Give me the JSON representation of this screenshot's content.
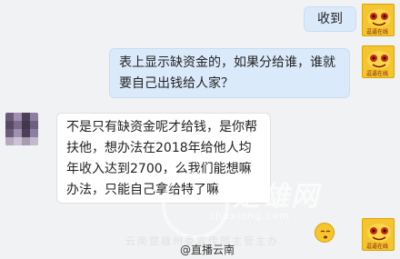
{
  "messages": [
    {
      "side": "me",
      "text": "收到"
    },
    {
      "side": "me",
      "text": "表上显示缺资金的，如果分给谁，谁就要自己出钱给人家？"
    },
    {
      "side": "other",
      "text": "不是只有缺资金呢才给钱，是你帮扶他，想办法在2018年给他人均年收入达到2700，么我们能想嘛办法，只能自己拿给特了嘛"
    }
  ],
  "self_avatar": {
    "caption": "逗逼在线"
  },
  "watermark": {
    "title": "楚雄网",
    "url": "chuxiong.com",
    "subtitle": "云南楚雄州委宣传部主管主办"
  },
  "credit": "@直播云南",
  "emoji_icon": "sleepy-face-emoji",
  "colors": {
    "self_bubble": "#dbeafb",
    "other_bubble": "#ffffff",
    "background": "#f1f2f3"
  }
}
